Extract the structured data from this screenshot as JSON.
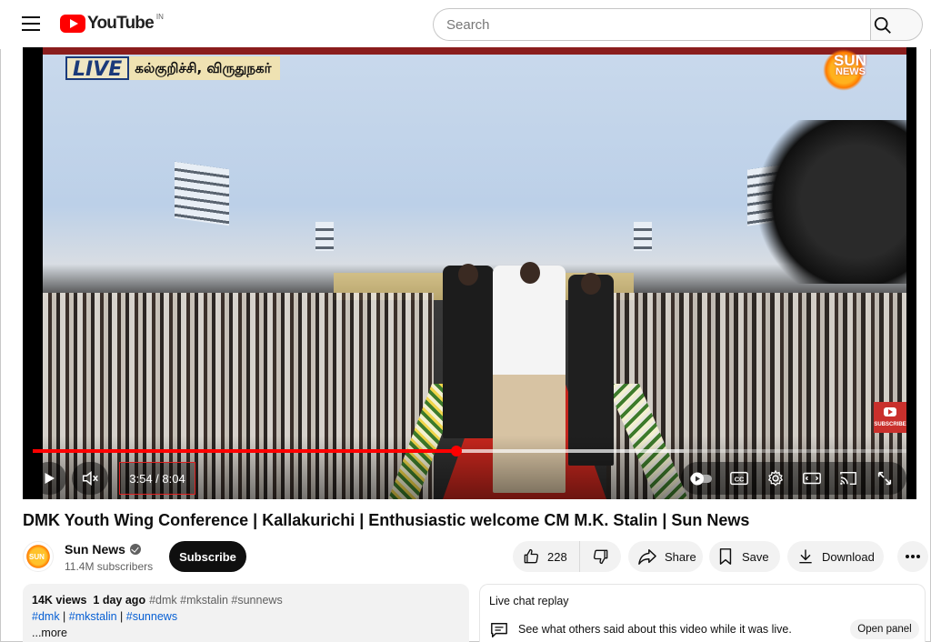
{
  "header": {
    "logo_text": "YouTube",
    "country_code": "IN",
    "search_placeholder": "Search"
  },
  "video": {
    "overlay_live": "LIVE",
    "overlay_location": "கல்குறிச்சி, விருதுநகர்",
    "channel_watermark": "SUN",
    "channel_watermark_sub": "NEWS",
    "subscribe_badge": "SUBSCRIBE",
    "current_time": "3:54",
    "duration": "8:04",
    "time_display": "3:54 / 8:04",
    "progress_played_fraction": 0.485,
    "progress_loaded_fraction": 0.745,
    "controls": [
      "play-icon",
      "mute-icon",
      "autoplay-toggle-icon",
      "captions-icon",
      "settings-icon",
      "theater-mode-icon",
      "cast-icon",
      "fullscreen-icon"
    ]
  },
  "title": "DMK Youth Wing Conference | Kallakurichi | Enthusiastic welcome CM M.K. Stalin | Sun News",
  "channel": {
    "avatar_text": "SUN",
    "name": "Sun News",
    "subscribers": "11.4M subscribers",
    "subscribe_label": "Subscribe"
  },
  "actions": {
    "likes": "228",
    "share_label": "Share",
    "save_label": "Save",
    "download_label": "Download"
  },
  "description": {
    "views": "14K views",
    "age": "1 day ago",
    "hashtags_inline": "#dmk #mkstalin #sunnews",
    "links": [
      "#dmk",
      "#mkstalin",
      "#sunnews"
    ],
    "more_label": "...more"
  },
  "chat": {
    "title": "Live chat replay",
    "text": "See what others said about this video while it was live.",
    "open_label": "Open panel"
  },
  "colors": {
    "brand_red": "#ff0000",
    "link_blue": "#065fd4",
    "highlight_box": "#e02020"
  }
}
